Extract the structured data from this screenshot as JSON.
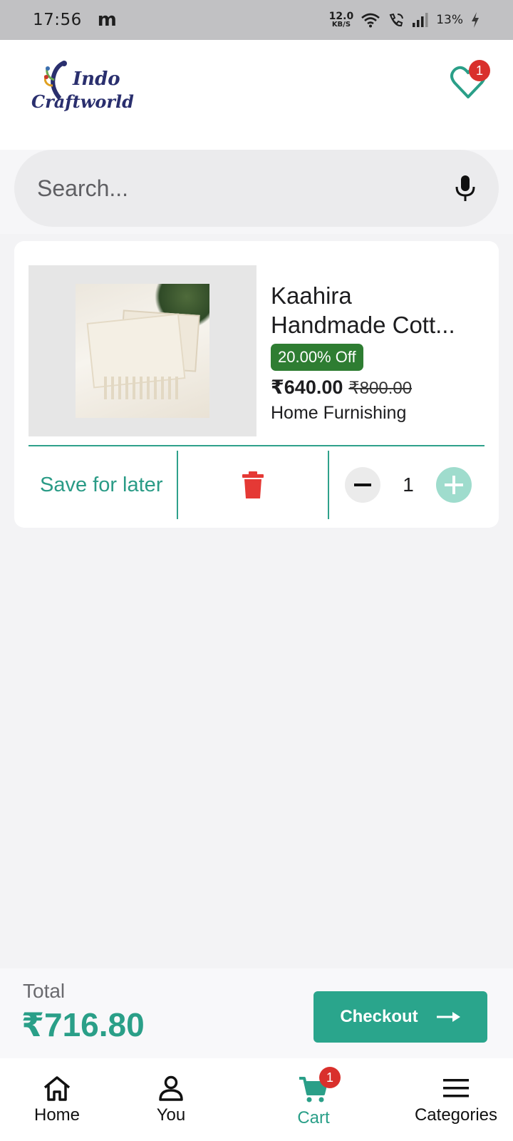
{
  "status_bar": {
    "time": "17:56",
    "app_icon": "m",
    "speed_value": "12.0",
    "speed_unit": "KB/S",
    "battery": "13%"
  },
  "header": {
    "logo_line1": "Indo",
    "logo_line2": "Craftworld",
    "wishlist_count": "1"
  },
  "search": {
    "placeholder": "Search..."
  },
  "cart_item": {
    "title": "Kaahira Handmade Cott...",
    "title_line1": "Kaahira",
    "title_line2": "Handmade Cott...",
    "discount": "20.00% Off",
    "price": "₹640.00",
    "mrp": "₹800.00",
    "category": "Home Furnishing",
    "save_label": "Save for later",
    "quantity": "1"
  },
  "total": {
    "label": "Total",
    "amount": "₹716.80",
    "checkout_label": "Checkout"
  },
  "bottom_nav": {
    "home": "Home",
    "you": "You",
    "cart": "Cart",
    "cart_count": "1",
    "categories": "Categories"
  },
  "colors": {
    "accent": "#2aa58c",
    "badge": "#d9302c",
    "discount_bg": "#2e7d32",
    "delete": "#e53935"
  }
}
